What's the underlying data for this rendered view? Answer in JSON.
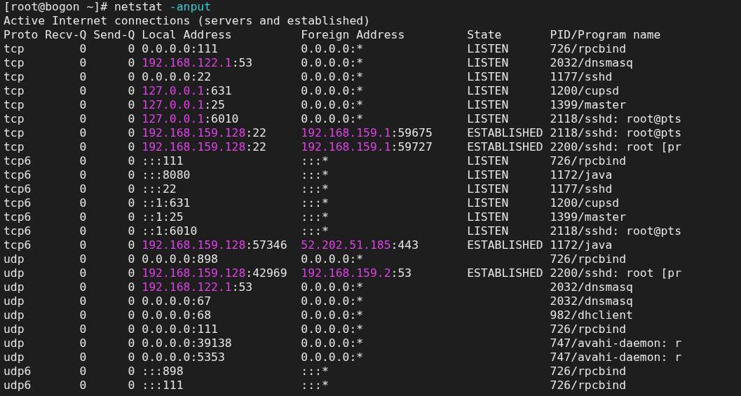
{
  "prompt": {
    "text": "[root@bogon ~]#",
    "command": "netstat",
    "option": "-anput"
  },
  "banner": "Active Internet connections (servers and established)",
  "columns": [
    "Proto",
    "Recv-Q",
    "Send-Q",
    "Local Address",
    "Foreign Address",
    "State",
    "PID/Program name"
  ],
  "rows": [
    {
      "proto": "tcp",
      "recv_q": "0",
      "send_q": "0",
      "local": {
        "host": "0.0.0.0",
        "port": ":111",
        "highlight": false
      },
      "foreign": {
        "host": "0.0.0.0",
        "port": ":*",
        "highlight": false
      },
      "state": "LISTEN",
      "program": "726/rpcbind"
    },
    {
      "proto": "tcp",
      "recv_q": "0",
      "send_q": "0",
      "local": {
        "host": "192.168.122.1",
        "port": ":53",
        "highlight": true
      },
      "foreign": {
        "host": "0.0.0.0",
        "port": ":*",
        "highlight": false
      },
      "state": "LISTEN",
      "program": "2032/dnsmasq"
    },
    {
      "proto": "tcp",
      "recv_q": "0",
      "send_q": "0",
      "local": {
        "host": "0.0.0.0",
        "port": ":22",
        "highlight": false
      },
      "foreign": {
        "host": "0.0.0.0",
        "port": ":*",
        "highlight": false
      },
      "state": "LISTEN",
      "program": "1177/sshd"
    },
    {
      "proto": "tcp",
      "recv_q": "0",
      "send_q": "0",
      "local": {
        "host": "127.0.0.1",
        "port": ":631",
        "highlight": true
      },
      "foreign": {
        "host": "0.0.0.0",
        "port": ":*",
        "highlight": false
      },
      "state": "LISTEN",
      "program": "1200/cupsd"
    },
    {
      "proto": "tcp",
      "recv_q": "0",
      "send_q": "0",
      "local": {
        "host": "127.0.0.1",
        "port": ":25",
        "highlight": true
      },
      "foreign": {
        "host": "0.0.0.0",
        "port": ":*",
        "highlight": false
      },
      "state": "LISTEN",
      "program": "1399/master"
    },
    {
      "proto": "tcp",
      "recv_q": "0",
      "send_q": "0",
      "local": {
        "host": "127.0.0.1",
        "port": ":6010",
        "highlight": true
      },
      "foreign": {
        "host": "0.0.0.0",
        "port": ":*",
        "highlight": false
      },
      "state": "LISTEN",
      "program": "2118/sshd: root@pts"
    },
    {
      "proto": "tcp",
      "recv_q": "0",
      "send_q": "0",
      "local": {
        "host": "192.168.159.128",
        "port": ":22",
        "highlight": true
      },
      "foreign": {
        "host": "192.168.159.1",
        "port": ":59675",
        "highlight": true
      },
      "state": "ESTABLISHED",
      "program": "2118/sshd: root@pts"
    },
    {
      "proto": "tcp",
      "recv_q": "0",
      "send_q": "0",
      "local": {
        "host": "192.168.159.128",
        "port": ":22",
        "highlight": true
      },
      "foreign": {
        "host": "192.168.159.1",
        "port": ":59727",
        "highlight": true
      },
      "state": "ESTABLISHED",
      "program": "2200/sshd: root [pr"
    },
    {
      "proto": "tcp6",
      "recv_q": "0",
      "send_q": "0",
      "local": {
        "host": "::",
        "port": ":111",
        "highlight": false
      },
      "foreign": {
        "host": "::",
        "port": ":*",
        "highlight": false
      },
      "state": "LISTEN",
      "program": "726/rpcbind"
    },
    {
      "proto": "tcp6",
      "recv_q": "0",
      "send_q": "0",
      "local": {
        "host": "::",
        "port": ":8080",
        "highlight": false
      },
      "foreign": {
        "host": "::",
        "port": ":*",
        "highlight": false
      },
      "state": "LISTEN",
      "program": "1172/java"
    },
    {
      "proto": "tcp6",
      "recv_q": "0",
      "send_q": "0",
      "local": {
        "host": "::",
        "port": ":22",
        "highlight": false
      },
      "foreign": {
        "host": "::",
        "port": ":*",
        "highlight": false
      },
      "state": "LISTEN",
      "program": "1177/sshd"
    },
    {
      "proto": "tcp6",
      "recv_q": "0",
      "send_q": "0",
      "local": {
        "host": "::1",
        "port": ":631",
        "highlight": false
      },
      "foreign": {
        "host": "::",
        "port": ":*",
        "highlight": false
      },
      "state": "LISTEN",
      "program": "1200/cupsd"
    },
    {
      "proto": "tcp6",
      "recv_q": "0",
      "send_q": "0",
      "local": {
        "host": "::1",
        "port": ":25",
        "highlight": false
      },
      "foreign": {
        "host": "::",
        "port": ":*",
        "highlight": false
      },
      "state": "LISTEN",
      "program": "1399/master"
    },
    {
      "proto": "tcp6",
      "recv_q": "0",
      "send_q": "0",
      "local": {
        "host": "::1",
        "port": ":6010",
        "highlight": false
      },
      "foreign": {
        "host": "::",
        "port": ":*",
        "highlight": false
      },
      "state": "LISTEN",
      "program": "2118/sshd: root@pts"
    },
    {
      "proto": "tcp6",
      "recv_q": "0",
      "send_q": "0",
      "local": {
        "host": "192.168.159.128",
        "port": ":57346",
        "highlight": true
      },
      "foreign": {
        "host": "52.202.51.185",
        "port": ":443",
        "highlight": true
      },
      "state": "ESTABLISHED",
      "program": "1172/java"
    },
    {
      "proto": "udp",
      "recv_q": "0",
      "send_q": "0",
      "local": {
        "host": "0.0.0.0",
        "port": ":898",
        "highlight": false
      },
      "foreign": {
        "host": "0.0.0.0",
        "port": ":*",
        "highlight": false
      },
      "program": "726/rpcbind"
    },
    {
      "proto": "udp",
      "recv_q": "0",
      "send_q": "0",
      "local": {
        "host": "192.168.159.128",
        "port": ":42969",
        "highlight": true
      },
      "foreign": {
        "host": "192.168.159.2",
        "port": ":53",
        "highlight": true
      },
      "state": "ESTABLISHED",
      "program": "2200/sshd: root [pr"
    },
    {
      "proto": "udp",
      "recv_q": "0",
      "send_q": "0",
      "local": {
        "host": "192.168.122.1",
        "port": ":53",
        "highlight": true
      },
      "foreign": {
        "host": "0.0.0.0",
        "port": ":*",
        "highlight": false
      },
      "program": "2032/dnsmasq"
    },
    {
      "proto": "udp",
      "recv_q": "0",
      "send_q": "0",
      "local": {
        "host": "0.0.0.0",
        "port": ":67",
        "highlight": false
      },
      "foreign": {
        "host": "0.0.0.0",
        "port": ":*",
        "highlight": false
      },
      "program": "2032/dnsmasq"
    },
    {
      "proto": "udp",
      "recv_q": "0",
      "send_q": "0",
      "local": {
        "host": "0.0.0.0",
        "port": ":68",
        "highlight": false
      },
      "foreign": {
        "host": "0.0.0.0",
        "port": ":*",
        "highlight": false
      },
      "program": "982/dhclient"
    },
    {
      "proto": "udp",
      "recv_q": "0",
      "send_q": "0",
      "local": {
        "host": "0.0.0.0",
        "port": ":111",
        "highlight": false
      },
      "foreign": {
        "host": "0.0.0.0",
        "port": ":*",
        "highlight": false
      },
      "program": "726/rpcbind"
    },
    {
      "proto": "udp",
      "recv_q": "0",
      "send_q": "0",
      "local": {
        "host": "0.0.0.0",
        "port": ":39138",
        "highlight": false
      },
      "foreign": {
        "host": "0.0.0.0",
        "port": ":*",
        "highlight": false
      },
      "program": "747/avahi-daemon: r"
    },
    {
      "proto": "udp",
      "recv_q": "0",
      "send_q": "0",
      "local": {
        "host": "0.0.0.0",
        "port": ":5353",
        "highlight": false
      },
      "foreign": {
        "host": "0.0.0.0",
        "port": ":*",
        "highlight": false
      },
      "program": "747/avahi-daemon: r"
    },
    {
      "proto": "udp6",
      "recv_q": "0",
      "send_q": "0",
      "local": {
        "host": "::",
        "port": ":898",
        "highlight": false
      },
      "foreign": {
        "host": "::",
        "port": ":*",
        "highlight": false
      },
      "program": "726/rpcbind"
    },
    {
      "proto": "udp6",
      "recv_q": "0",
      "send_q": "0",
      "local": {
        "host": "::",
        "port": ":111",
        "highlight": false
      },
      "foreign": {
        "host": "::",
        "port": ":*",
        "highlight": false
      },
      "program": "726/rpcbind"
    }
  ]
}
